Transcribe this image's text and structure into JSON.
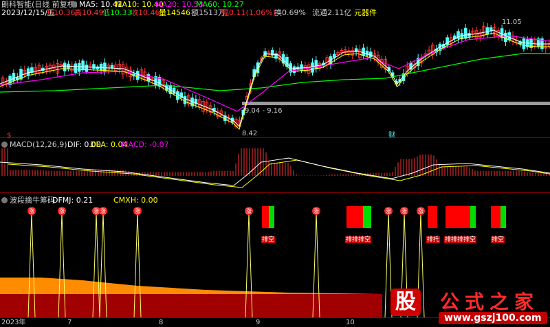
{
  "header": {
    "title": "朗科智能(日线 前复权)",
    "ma5": "MA5: 10.41",
    "ma10": "MA10: 10.40",
    "ma20": "MA20: 10.53",
    "ma60": "MA60: 10.27",
    "date": "2023/12/15/五",
    "open": "开10.36",
    "high": "高10.49",
    "low": "低10.33",
    "close": "收10.46",
    "volume": "量14546",
    "amount": "额1513万",
    "change": "幅0.11(1.06%)",
    "turnover": "换0.69%",
    "float": "流通2.11亿",
    "sector": "元器件"
  },
  "price_notes": {
    "peak": "11.05",
    "range": "9.04 - 9.16",
    "low": "8.42",
    "flag_s": "$",
    "flag_cai": "财"
  },
  "macd": {
    "title": "MACD(12,26,9)",
    "dif": "DIF: 0.00",
    "dea": "DEA: 0.04",
    "macd": "MACD: -0.07"
  },
  "indicator": {
    "title": "波段擒牛筹码",
    "dfmj": "DFMJ: 0.21",
    "cmxh": "CMXH: 0.00",
    "marker_label": "涨",
    "tags": [
      "排空",
      "排排排空",
      "排托",
      "排排排排空",
      "排空"
    ]
  },
  "xaxis": {
    "labels": [
      "2023年",
      "7",
      "8",
      "9",
      "10"
    ]
  },
  "watermark": {
    "logo": "股",
    "name": "公式之家",
    "url": "www.gszj100.com"
  },
  "colors": {
    "ma5": "#ffffff",
    "ma10": "#ffff00",
    "ma20": "#ff00ff",
    "ma60": "#00ff00",
    "up": "#ff3232",
    "down": "#54ffff",
    "area_upper": "#ff8c00",
    "area_lower": "#a00000"
  }
}
